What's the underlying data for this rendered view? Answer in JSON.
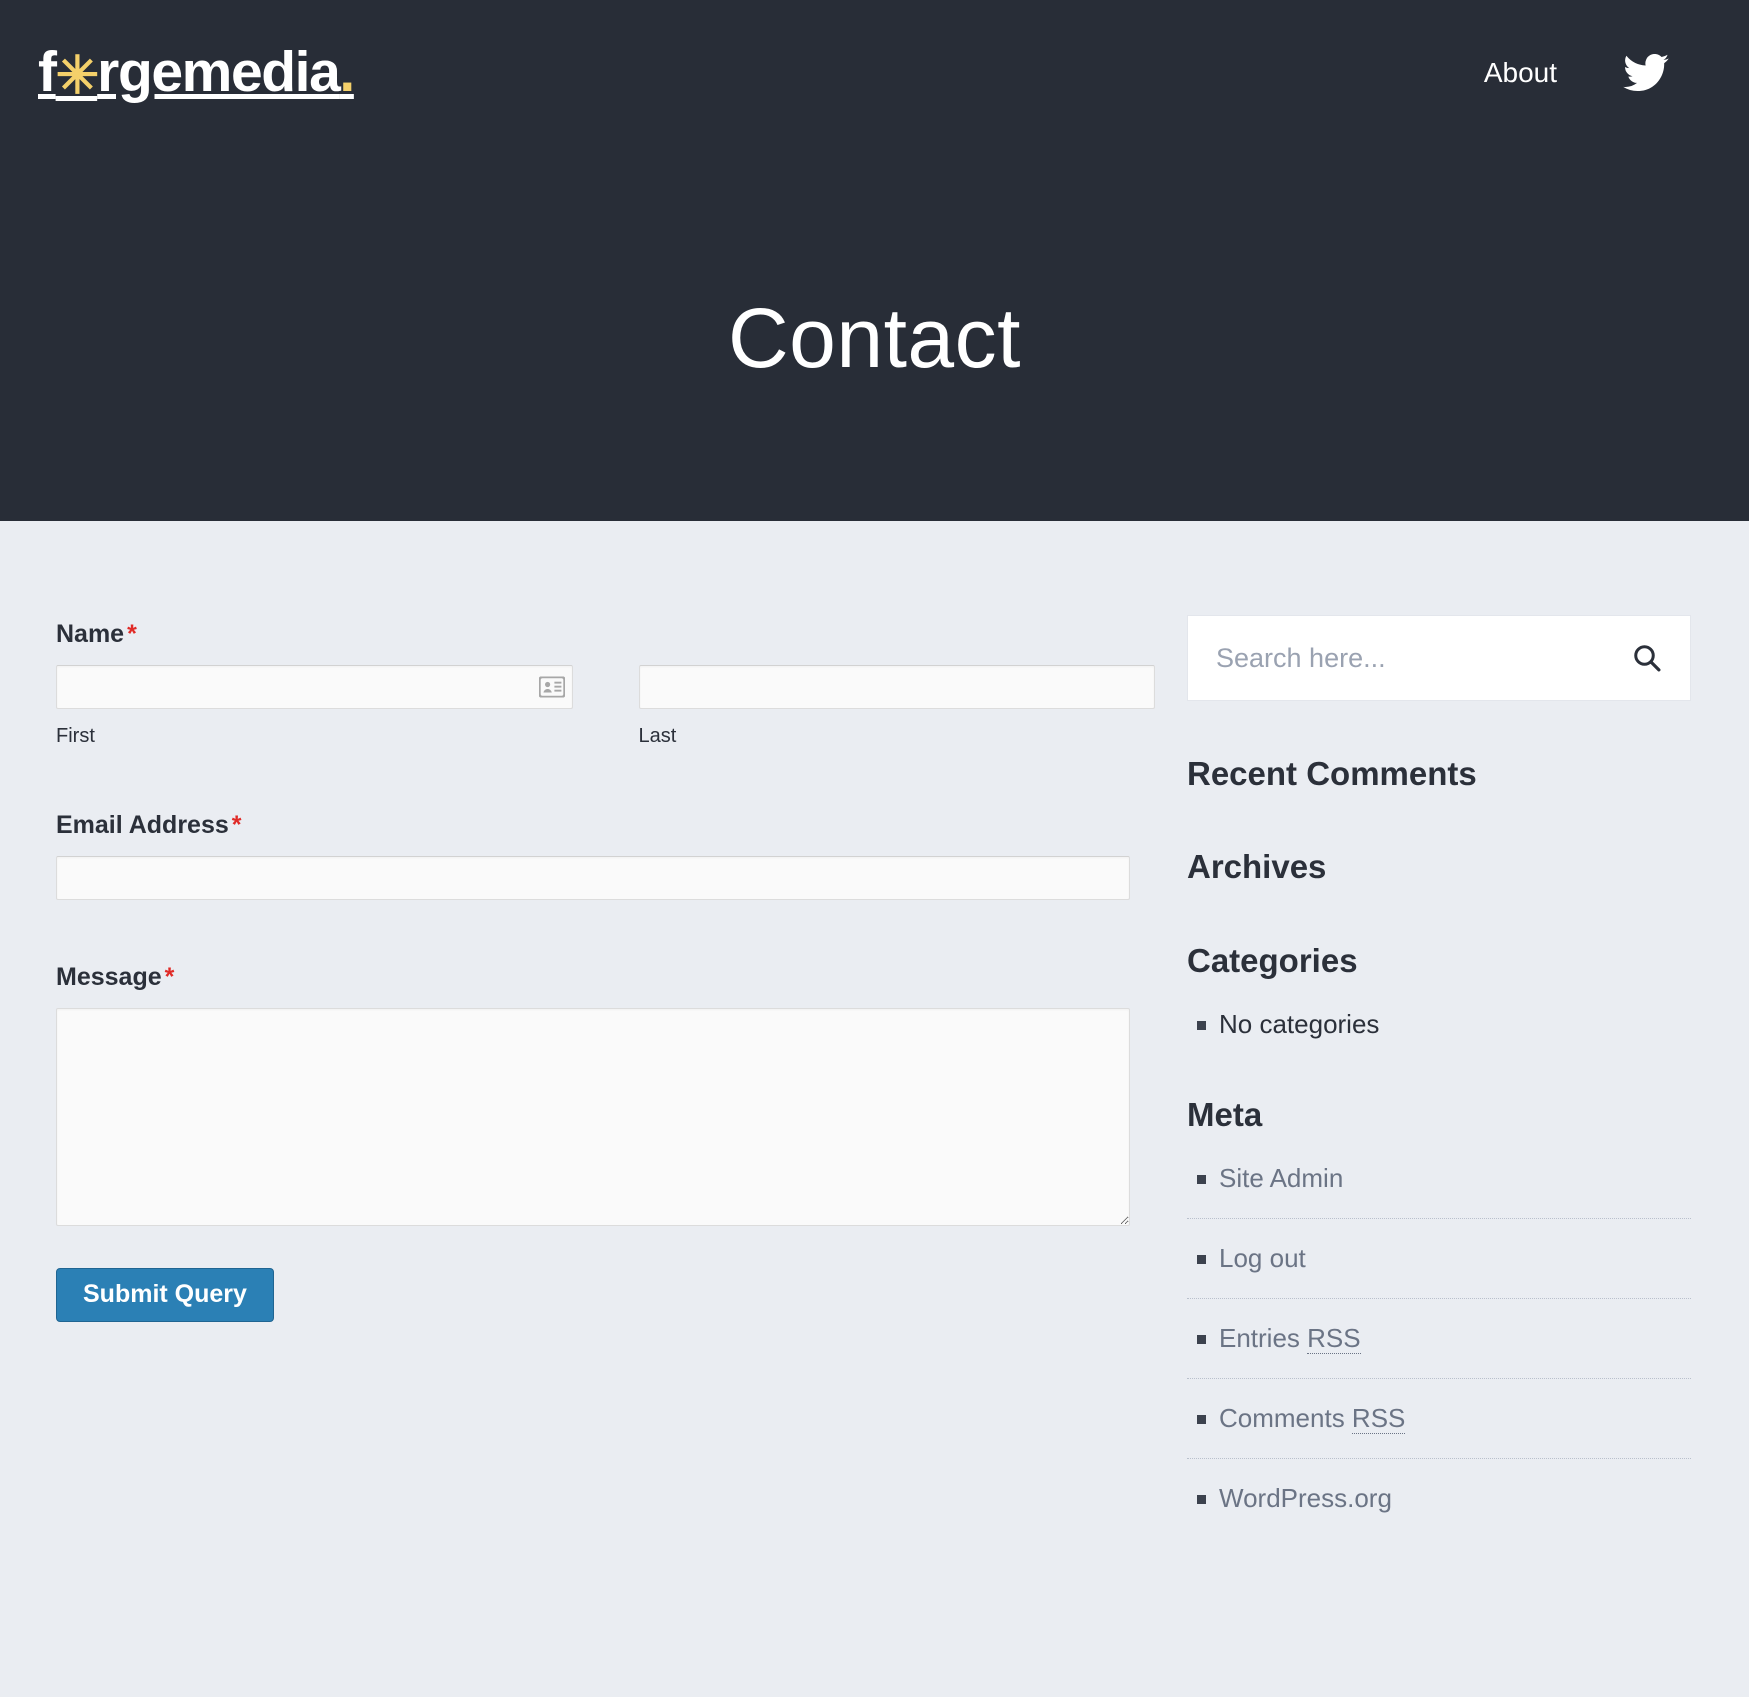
{
  "site": {
    "brand_prefix": "f",
    "brand_star": "✳",
    "brand_suffix": "rgemedia",
    "brand_dot": ".",
    "brand_full": "f*rgemedia.",
    "accent_color": "#f4d06a",
    "header_bg": "#282d37",
    "page_bg": "#eaedf2"
  },
  "nav": {
    "items": [
      {
        "label": "About",
        "icon": "text-link"
      }
    ],
    "social": {
      "icon": "twitter-icon",
      "label": "Twitter"
    }
  },
  "hero": {
    "title": "Contact"
  },
  "form": {
    "name": {
      "label": "Name",
      "required_marker": "*",
      "first": {
        "sub_label": "First",
        "value": "",
        "placeholder": "",
        "autofill_icon": "contact-card-icon"
      },
      "last": {
        "sub_label": "Last",
        "value": "",
        "placeholder": ""
      }
    },
    "email": {
      "label": "Email Address",
      "required_marker": "*",
      "value": "",
      "placeholder": ""
    },
    "message": {
      "label": "Message",
      "required_marker": "*",
      "value": "",
      "placeholder": ""
    },
    "submit": {
      "label": "Submit Query",
      "color": "#2b80b5"
    }
  },
  "sidebar": {
    "search": {
      "placeholder": "Search here...",
      "value": "",
      "icon": "search-icon"
    },
    "widgets": [
      {
        "title": "Recent Comments",
        "items": []
      },
      {
        "title": "Archives",
        "items": []
      },
      {
        "title": "Categories",
        "items": [
          {
            "label": "No categories",
            "is_link": false
          }
        ]
      },
      {
        "title": "Meta",
        "items": [
          {
            "label": "Site Admin",
            "is_link": true
          },
          {
            "label": "Log out",
            "is_link": true
          },
          {
            "label": "Entries ",
            "abbr": "RSS",
            "is_link": true
          },
          {
            "label": "Comments ",
            "abbr": "RSS",
            "is_link": true
          },
          {
            "label": "WordPress.org",
            "is_link": true
          }
        ]
      }
    ]
  }
}
